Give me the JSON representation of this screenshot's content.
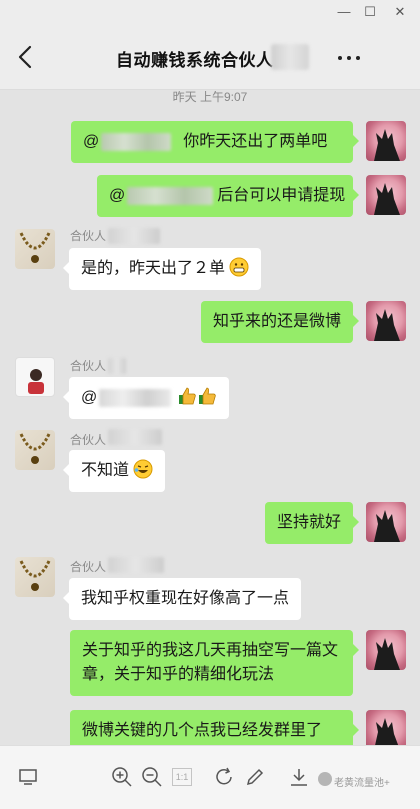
{
  "window": {
    "minimize_glyph": "—",
    "maximize_glyph": "☐",
    "close_glyph": "✕"
  },
  "header": {
    "title": "自动赚钱系统合伙人"
  },
  "chat": {
    "timestamp": "昨天 上午9:07",
    "messages": [
      {
        "side": "out",
        "prefix": "@",
        "text": "你昨天还出了两单吧"
      },
      {
        "side": "out",
        "prefix": "@",
        "text": "后台可以申请提现"
      },
      {
        "side": "in",
        "sender": "合伙人",
        "text": "是的，昨天出了２单",
        "emoji": "grin-emoji"
      },
      {
        "side": "out",
        "text": "知乎来的还是微博"
      },
      {
        "side": "in",
        "sender": "合伙人",
        "prefix": "@",
        "emoji": "thumbs-up-emoji"
      },
      {
        "side": "in",
        "sender": "合伙人",
        "text": "不知道",
        "emoji": "laugh-tears-emoji"
      },
      {
        "side": "out",
        "text": "坚持就好"
      },
      {
        "side": "in",
        "sender": "合伙人",
        "text": "我知乎权重现在好像高了一点"
      },
      {
        "side": "out",
        "text": "关于知乎的我这几天再抽空写一篇文章，关于知乎的精细化玩法"
      },
      {
        "side": "out",
        "text": "微博关键的几个点我已经发群里了"
      }
    ]
  },
  "toolbar": {
    "page_label": "1:1",
    "watermark": "老黄流量池+"
  },
  "colors": {
    "outgoing_bubble": "#95ec69",
    "incoming_bubble": "#ffffff",
    "chat_background": "#e3e3e3"
  }
}
